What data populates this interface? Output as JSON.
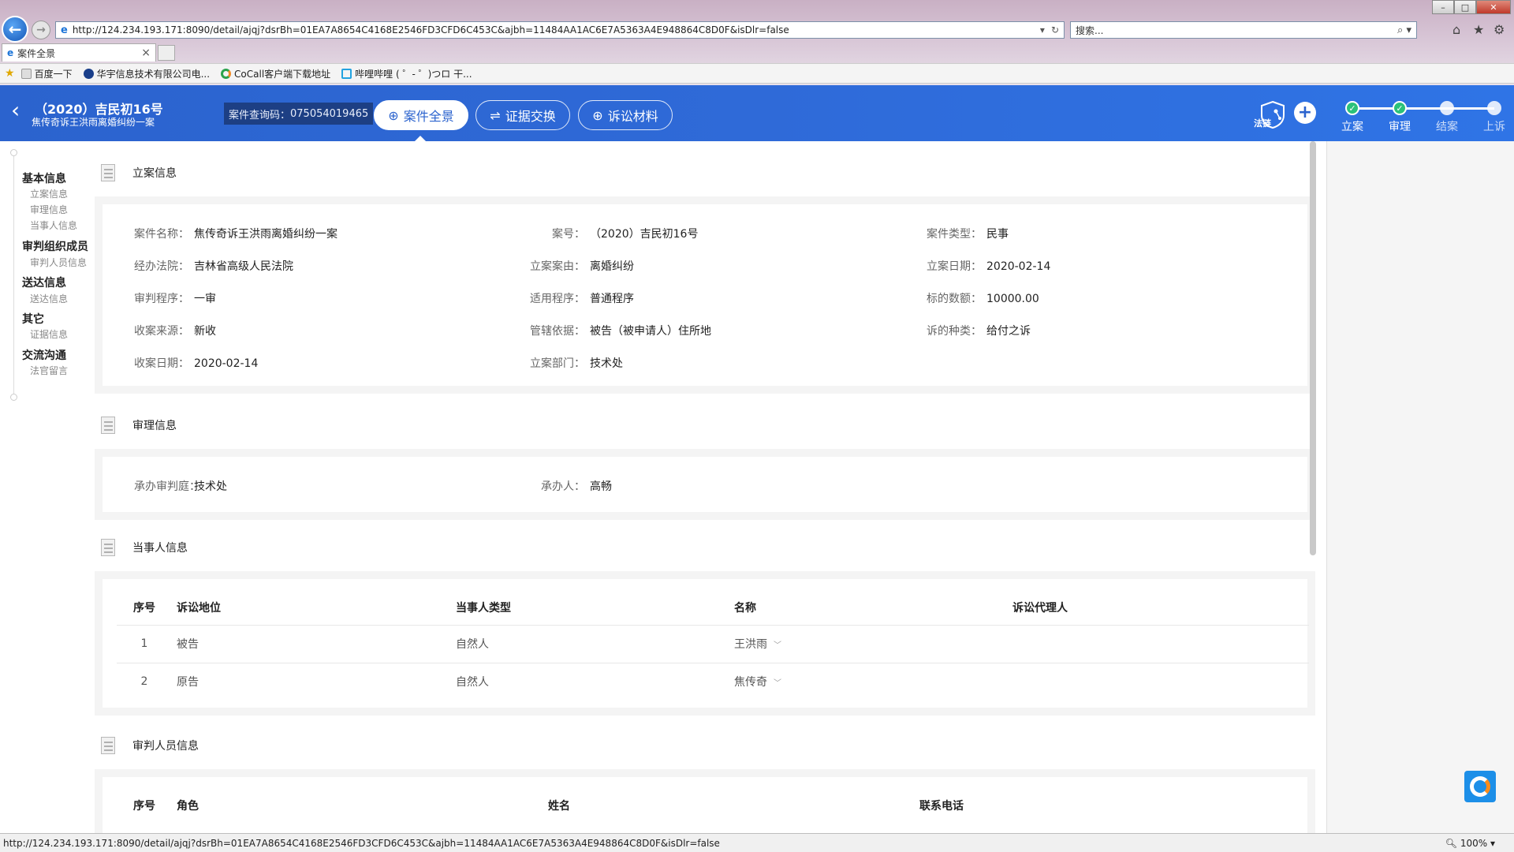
{
  "browser": {
    "url": "http://124.234.193.171:8090/detail/ajqj?dsrBh=01EA7A8654C4168E2546FD3CFD6C453C&ajbh=11484AA1AC6E7A5363A4E948864C8D0F&isDlr=false",
    "search_placeholder": "搜索...",
    "tab_title": "案件全景",
    "tab_close": "×",
    "favorites": [
      "百度一下",
      "华宇信息技术有限公司电...",
      "CoCall客户端下载地址",
      "哔哩哔哩 ( ゜- ゜)つロ 干..."
    ],
    "status_url": "http://124.234.193.171:8090/detail/ajqj?dsrBh=01EA7A8654C4168E2546FD3CFD6C453C&ajbh=11484AA1AC6E7A5363A4E948864C8D0F&isDlr=false",
    "zoom": "100%"
  },
  "header": {
    "case_no": "（2020）吉民初16号",
    "case_name": "焦传奇诉王洪雨离婚纠纷一案",
    "query_code_label": "案件查询码：",
    "query_code": "075054019465",
    "tabs": {
      "overview": "案件全景",
      "evidence": "证据交换",
      "materials": "诉讼材料"
    },
    "fl_badge": "法链",
    "steps": [
      "立案",
      "审理",
      "结案",
      "上诉"
    ]
  },
  "sidebar": {
    "groups": [
      {
        "label": "基本信息",
        "items": [
          "立案信息",
          "审理信息",
          "当事人信息"
        ]
      },
      {
        "label": "审判组织成员",
        "items": [
          "审判人员信息"
        ]
      },
      {
        "label": "送达信息",
        "items": [
          "送达信息"
        ]
      },
      {
        "label": "其它",
        "items": [
          "证据信息"
        ]
      },
      {
        "label": "交流沟通",
        "items": [
          "法官留言"
        ]
      }
    ]
  },
  "filing": {
    "title": "立案信息",
    "fields": [
      {
        "k": "案件名称：",
        "v": "焦传奇诉王洪雨离婚纠纷一案"
      },
      {
        "k": "案号：",
        "v": "（2020）吉民初16号"
      },
      {
        "k": "案件类型：",
        "v": "民事"
      },
      {
        "k": "经办法院：",
        "v": "吉林省高级人民法院"
      },
      {
        "k": "立案案由：",
        "v": "离婚纠纷"
      },
      {
        "k": "立案日期：",
        "v": "2020-02-14"
      },
      {
        "k": "审判程序：",
        "v": "一审"
      },
      {
        "k": "适用程序：",
        "v": "普通程序"
      },
      {
        "k": "标的数额：",
        "v": "10000.00"
      },
      {
        "k": "收案来源：",
        "v": "新收"
      },
      {
        "k": "管辖依据：",
        "v": "被告（被申请人）住所地"
      },
      {
        "k": "诉的种类：",
        "v": "给付之诉"
      },
      {
        "k": "收案日期：",
        "v": "2020-02-14"
      },
      {
        "k": "立案部门：",
        "v": "技术处"
      }
    ]
  },
  "trial": {
    "title": "审理信息",
    "fields": [
      {
        "k": "承办审判庭：",
        "v": "技术处"
      },
      {
        "k": "承办人：",
        "v": "高畅"
      }
    ]
  },
  "parties": {
    "title": "当事人信息",
    "columns": [
      "序号",
      "诉讼地位",
      "当事人类型",
      "名称",
      "诉讼代理人"
    ],
    "rows": [
      {
        "no": "1",
        "role": "被告",
        "type": "自然人",
        "name": "王洪雨",
        "agent": ""
      },
      {
        "no": "2",
        "role": "原告",
        "type": "自然人",
        "name": "焦传奇",
        "agent": ""
      }
    ]
  },
  "judges": {
    "title": "审判人员信息",
    "columns": [
      "序号",
      "角色",
      "姓名",
      "联系电话"
    ]
  },
  "colors": {
    "header_blue": "#2f6ad8",
    "step_done": "#2bc27a"
  }
}
